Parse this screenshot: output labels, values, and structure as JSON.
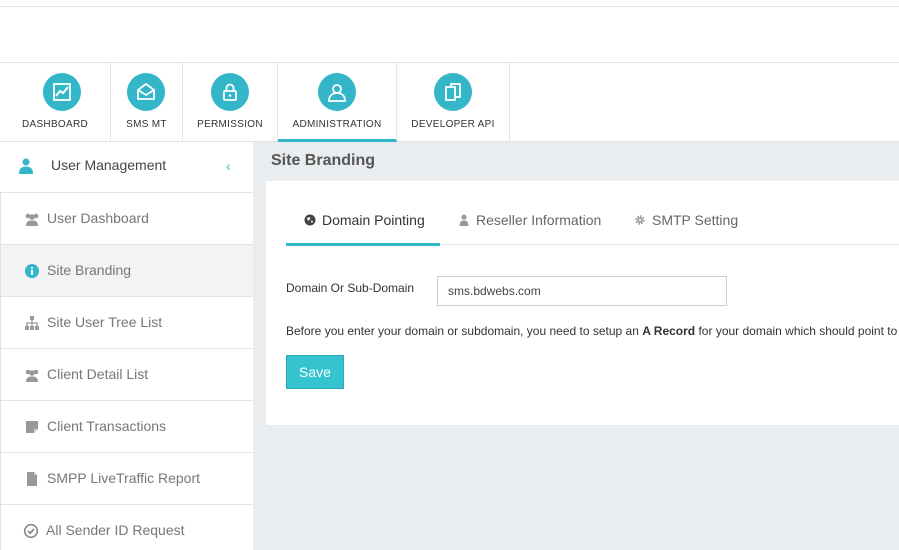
{
  "nav": {
    "items": [
      {
        "label": "DASHBOARD",
        "icon": "chart-line-icon"
      },
      {
        "label": "SMS MT",
        "icon": "envelope-icon"
      },
      {
        "label": "PERMISSION",
        "icon": "lock-icon"
      },
      {
        "label": "ADMINISTRATION",
        "icon": "user-icon"
      },
      {
        "label": "DEVELOPER API",
        "icon": "documents-icon"
      }
    ],
    "active": "ADMINISTRATION"
  },
  "sidebar": {
    "header": {
      "title": "User Management",
      "icon": "user-icon",
      "toggle": "‹"
    },
    "items": [
      {
        "label": "User Dashboard",
        "icon": "users-icon"
      },
      {
        "label": "Site Branding",
        "icon": "info-circle-icon"
      },
      {
        "label": "Site User Tree List",
        "icon": "sitemap-icon"
      },
      {
        "label": "Client Detail List",
        "icon": "users-icon"
      },
      {
        "label": "Client Transactions",
        "icon": "sticky-note-icon"
      },
      {
        "label": "SMPP LiveTraffic Report",
        "icon": "file-icon"
      },
      {
        "label": "All Sender ID Request",
        "icon": "check-circle-icon"
      }
    ],
    "active": "Site Branding"
  },
  "main": {
    "title": "Site Branding",
    "tabs": [
      {
        "label": "Domain Pointing",
        "icon": "globe-icon"
      },
      {
        "label": "Reseller Information",
        "icon": "user-icon"
      },
      {
        "label": "SMTP Setting",
        "icon": "gear-icon"
      }
    ],
    "active_tab": "Domain Pointing",
    "form": {
      "domain_label": "Domain Or Sub-Domain",
      "domain_value": "sms.bdwebs.com",
      "note_prefix": "Before you enter your domain or subdomain, you need to setup an ",
      "note_bold": "A Record",
      "note_suffix": " for your domain which should point to",
      "save_label": "Save"
    }
  },
  "colors": {
    "accent": "#34b6c9",
    "button": "#34c3cf",
    "content_bg": "#eaedf0"
  }
}
